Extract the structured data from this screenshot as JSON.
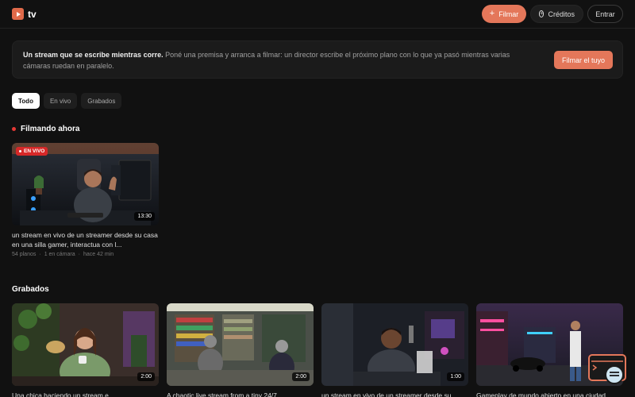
{
  "header": {
    "logo_text": "tv",
    "filmar_label": "Filmar",
    "creditos_label": "Créditos",
    "entrar_label": "Entrar",
    "accent": "#e4775a"
  },
  "banner": {
    "lead": "Un stream que se escribe mientras corre.",
    "body": " Poné una premisa y arranca a filmar: un director escribe el próximo plano con lo que ya pasó mientras varias cámaras ruedan en paralelo.",
    "button_label": "Filmar el tuyo"
  },
  "tabs": [
    {
      "label": "Todo",
      "active": true
    },
    {
      "label": "En vivo",
      "active": false
    },
    {
      "label": "Grabados",
      "active": false
    }
  ],
  "live_section": {
    "title": "Filmando ahora",
    "cards": [
      {
        "badge": "EN VIVO",
        "duration": "13:30",
        "title": "un stream en vivo de un streamer desde su casa en una silla gamer, interactua con l...",
        "planos": "54 planos",
        "camaras": "1 en cámara",
        "time": "hace 42 min"
      }
    ]
  },
  "recorded_section": {
    "title": "Grabados",
    "cards": [
      {
        "duration": "2:00",
        "title": "Una chica haciendo un stream e..."
      },
      {
        "duration": "2:00",
        "title": "A chaotic live stream from a tiny 24/7..."
      },
      {
        "duration": "1:00",
        "title": "un stream en vivo de un streamer desde su..."
      },
      {
        "duration": "",
        "title": "Gameplay de mundo abierto en una ciudad..."
      }
    ]
  },
  "meta_separator": "·"
}
